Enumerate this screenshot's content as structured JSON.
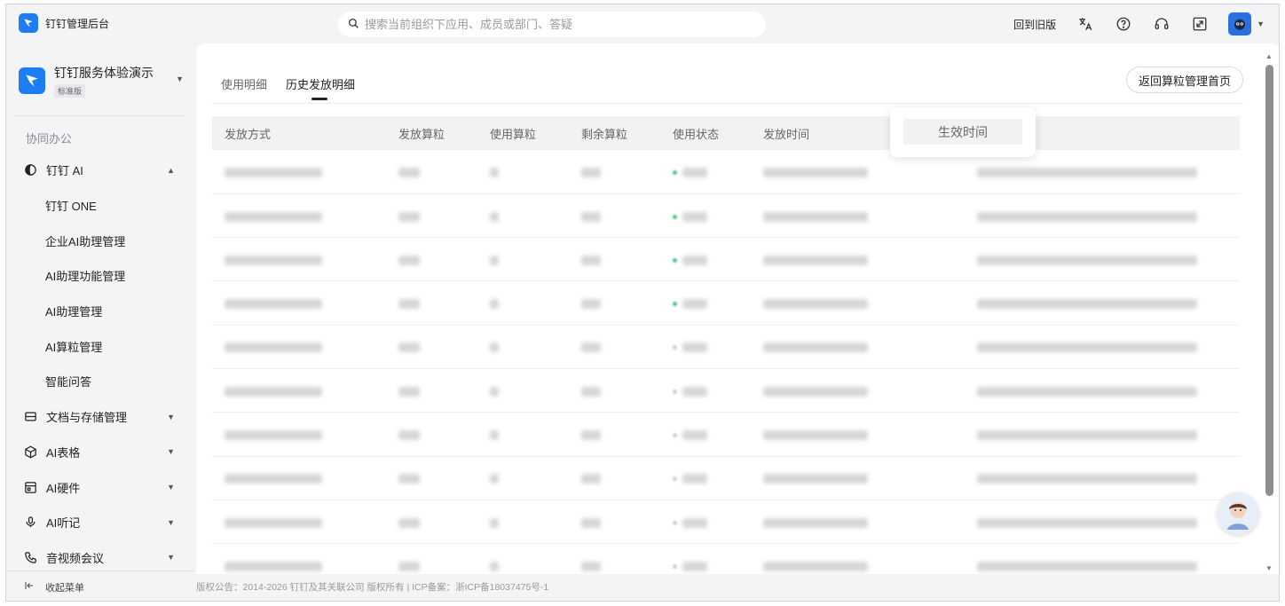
{
  "topbar": {
    "title": "钉钉管理后台",
    "search_placeholder": "搜索当前组织下应用、成员或部门、答疑",
    "old_version": "回到旧版",
    "icons": [
      "translate-icon",
      "help-icon",
      "headset-icon",
      "fullscreen-icon",
      "avatar",
      "chevron-down-icon"
    ]
  },
  "sidebar": {
    "org_name": "钉钉服务体验演示",
    "org_badge": "标准版",
    "group_label": "协同办公",
    "items": [
      {
        "label": "钉钉 AI",
        "icon": "ai-icon",
        "expanded": true
      },
      {
        "label": "钉钉 ONE"
      },
      {
        "label": "企业AI助理管理"
      },
      {
        "label": "AI助理功能管理"
      },
      {
        "label": "AI助理管理"
      },
      {
        "label": "AI算粒管理"
      },
      {
        "label": "智能问答"
      },
      {
        "label": "文档与存储管理",
        "icon": "storage-icon"
      },
      {
        "label": "AI表格",
        "icon": "cube-icon"
      },
      {
        "label": "AI硬件",
        "icon": "hardware-icon"
      },
      {
        "label": "AI听记",
        "icon": "mic-icon"
      },
      {
        "label": "音视频会议",
        "icon": "phone-icon"
      }
    ],
    "collapse_label": "收起菜单"
  },
  "main": {
    "tabs": [
      {
        "label": "使用明细"
      },
      {
        "label": "历史发放明细",
        "active": true
      }
    ],
    "back_button": "返回算粒管理首页",
    "columns": [
      "发放方式",
      "发放算粒",
      "使用算粒",
      "剩余算粒",
      "使用状态",
      "发放时间",
      "生效时间"
    ],
    "highlighted_column": "生效时间",
    "row_count": 10
  },
  "footer": "版权公告：2014-2026 钉钉及其关联公司 版权所有 | ICP备案：浙ICP备18037475号-1"
}
